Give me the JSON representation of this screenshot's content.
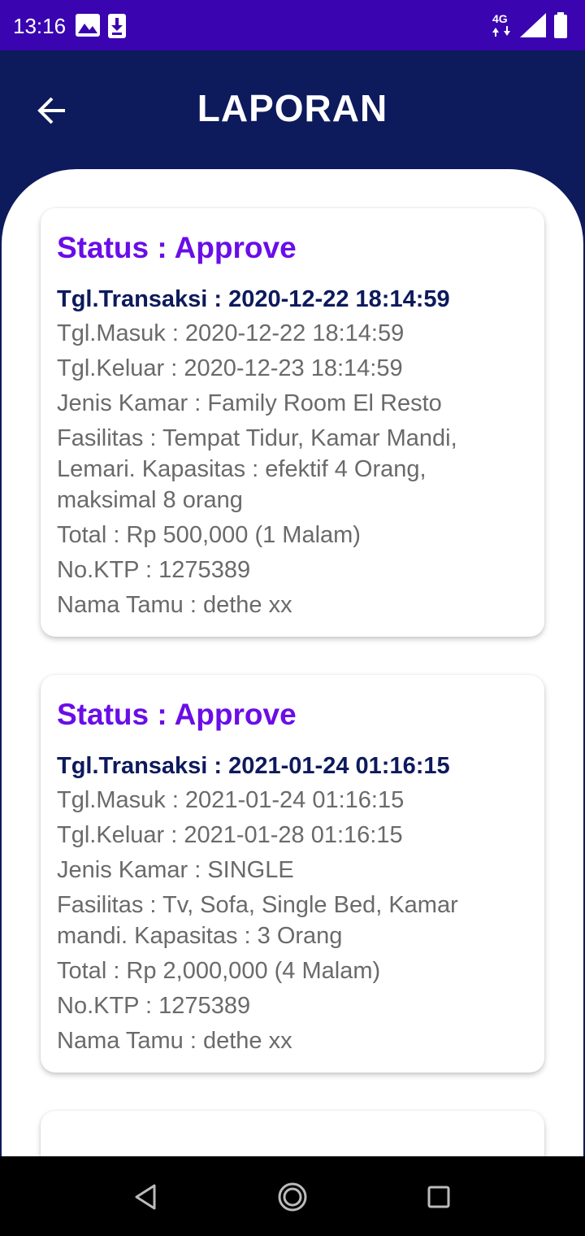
{
  "status_bar": {
    "time": "13:16",
    "icons": [
      "image-icon",
      "download-icon",
      "4g-signal-icon",
      "battery-icon"
    ]
  },
  "header": {
    "title": "LAPORAN",
    "back_icon": "arrow-left-icon"
  },
  "reports": [
    {
      "status": "Status : Approve",
      "tgl_transaksi": "Tgl.Transaksi : 2020-12-22 18:14:59",
      "tgl_masuk": "Tgl.Masuk : 2020-12-22 18:14:59",
      "tgl_keluar": "Tgl.Keluar : 2020-12-23 18:14:59",
      "jenis_kamar": "Jenis Kamar : Family Room El Resto",
      "fasilitas": "Fasilitas : Tempat Tidur, Kamar Mandi, Lemari. Kapasitas : efektif 4 Orang, maksimal 8 orang",
      "total": "Total : Rp 500,000 (1 Malam)",
      "no_ktp": "No.KTP : 1275389",
      "nama_tamu": "Nama Tamu : dethe xx"
    },
    {
      "status": "Status : Approve",
      "tgl_transaksi": "Tgl.Transaksi : 2021-01-24 01:16:15",
      "tgl_masuk": "Tgl.Masuk : 2021-01-24 01:16:15",
      "tgl_keluar": "Tgl.Keluar : 2021-01-28 01:16:15",
      "jenis_kamar": "Jenis Kamar : SINGLE",
      "fasilitas": "Fasilitas : Tv, Sofa, Single Bed, Kamar mandi. Kapasitas : 3 Orang",
      "total": "Total : Rp 2,000,000 (4 Malam)",
      "no_ktp": "No.KTP : 1275389",
      "nama_tamu": "Nama Tamu : dethe xx"
    }
  ],
  "nav_bar": {
    "icons": [
      "back-triangle-icon",
      "home-circle-icon",
      "recents-square-icon"
    ]
  },
  "colors": {
    "status_bar": "#3a05b0",
    "app_bar": "#0d1a5c",
    "status_text": "#6a0de8",
    "body_text": "#6a6a6a"
  }
}
